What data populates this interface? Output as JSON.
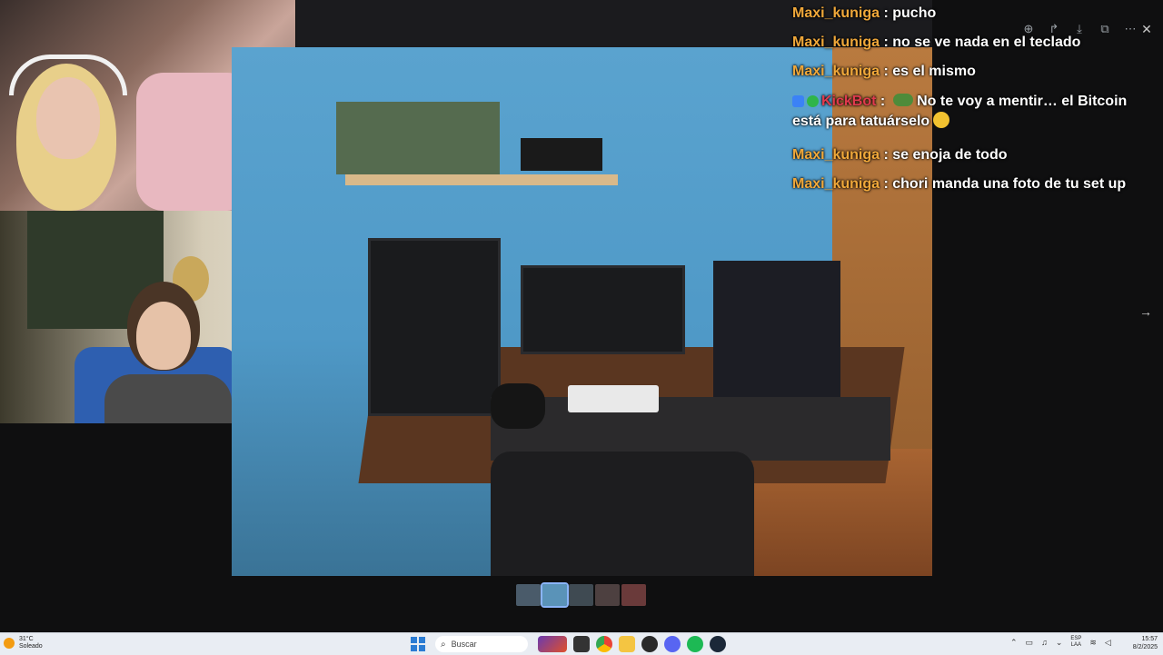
{
  "chat": {
    "messages": [
      {
        "user": "Maxi_kuniga",
        "sep": " : ",
        "text": "pucho"
      },
      {
        "user": "Maxi_kuniga",
        "sep": " : ",
        "text": "no se ve nada en el teclado"
      },
      {
        "user": "Maxi_kuniga",
        "sep": " : ",
        "text": "es el mismo"
      },
      {
        "user": "KickBot",
        "sep": " : ",
        "text": "No te voy a mentir… el Bitcoin está para tatuárselo"
      },
      {
        "user": "Maxi_kuniga",
        "sep": " : ",
        "text": "se enoja de todo"
      },
      {
        "user": "Maxi_kuniga",
        "sep": " : ",
        "text": "chori manda una foto de tu set up"
      }
    ],
    "colors": {
      "user": "#f0a83a",
      "bot": "#e03a4e"
    }
  },
  "viewer_toolbar": {
    "icons": [
      "zoom-in-icon",
      "share-icon",
      "download-icon",
      "open-external-icon",
      "more-icon",
      "close-icon"
    ]
  },
  "taskbar": {
    "weather": {
      "temp": "31°C",
      "condition": "Soleado"
    },
    "search_placeholder": "Buscar",
    "lang_top": "ESP",
    "lang_bottom": "LAA",
    "time": "15:57",
    "date": "8/2/2025"
  }
}
